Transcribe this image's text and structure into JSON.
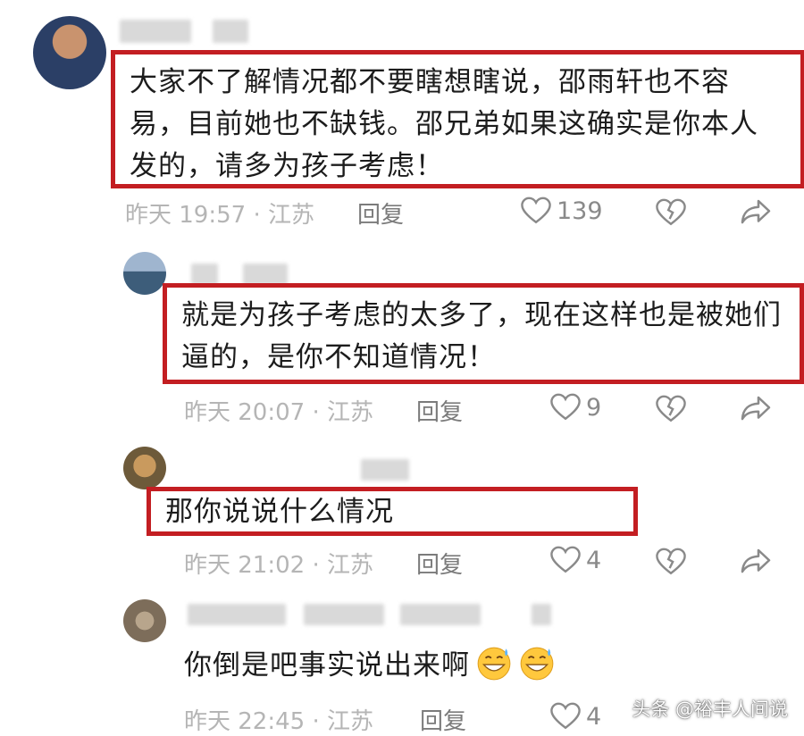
{
  "comments": [
    {
      "text": "大家不了解情况都不要瞎想瞎说，邵雨轩也不容易，目前她也不缺钱。邵兄弟如果这确实是你本人发的，请多为孩子考虑！",
      "time": "昨天 19:57 · 江苏",
      "reply_label": "回复",
      "likes": "139"
    },
    {
      "text": "就是为孩子考虑的太多了，现在这样也是被她们逼的，是你不知道情况！",
      "time": "昨天 20:07 · 江苏",
      "reply_label": "回复",
      "likes": "9"
    },
    {
      "text": "那你说说什么情况",
      "time": "昨天 21:02 · 江苏",
      "reply_label": "回复",
      "likes": "4"
    },
    {
      "text": "你倒是吧事实说出来啊",
      "time": "昨天 22:45 · 江苏",
      "reply_label": "回复",
      "likes": "4"
    }
  ],
  "watermark": "头条 @裕丰人间说",
  "icons": [
    "heart-icon",
    "broken-heart-icon",
    "share-arrow-icon",
    "grinning-sweat-emoji"
  ],
  "colors": {
    "highlight_border": "#c31e22",
    "meta_text": "#b5b5b5",
    "icon": "#8a8a8a"
  }
}
